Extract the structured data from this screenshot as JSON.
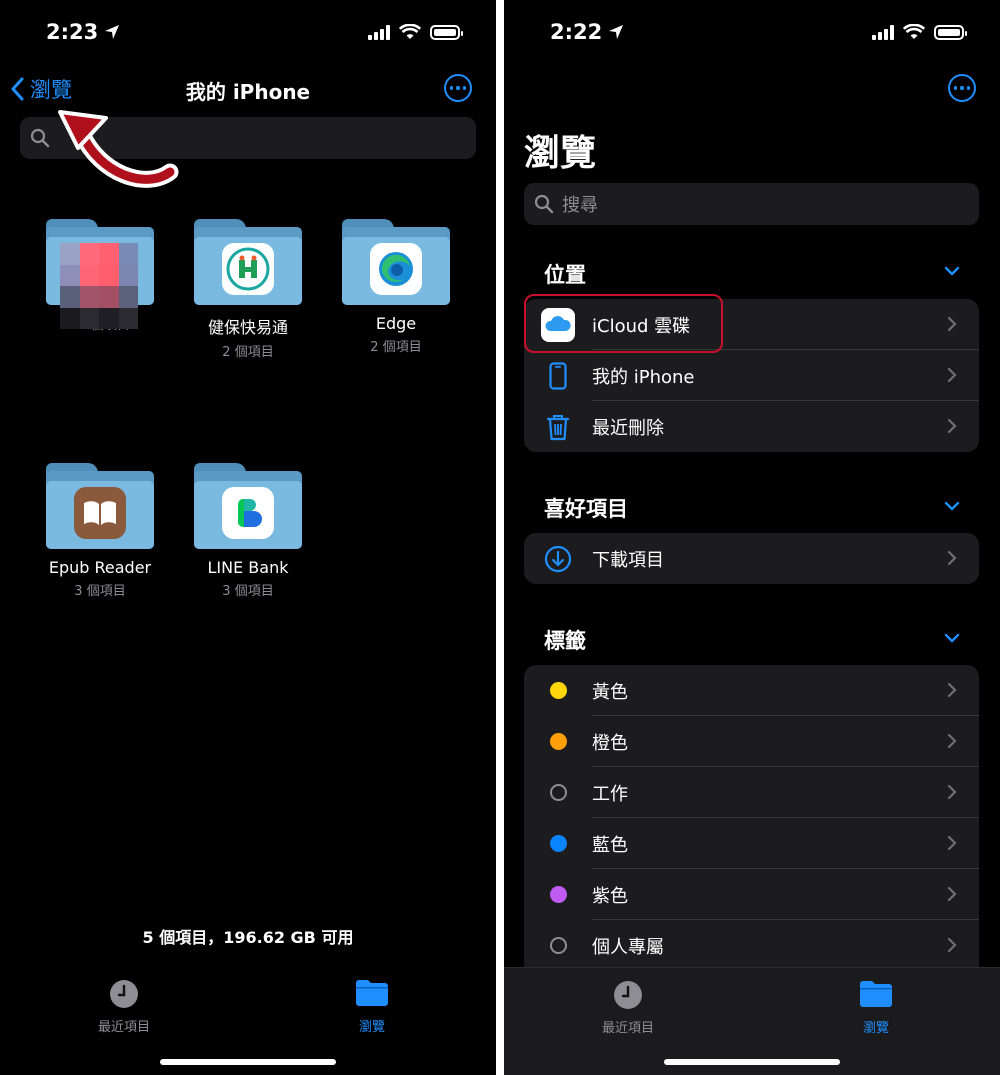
{
  "left": {
    "status_time": "2:23",
    "back_label": "瀏覽",
    "title": "我的 iPhone",
    "folders": [
      {
        "name": "",
        "count": "22 個項目"
      },
      {
        "name": "健保快易通",
        "count": "2 個項目"
      },
      {
        "name": "Edge",
        "count": "2 個項目"
      },
      {
        "name": "Epub Reader",
        "count": "3 個項目"
      },
      {
        "name": "LINE Bank",
        "count": "3 個項目"
      }
    ],
    "storage": "5 個項目，196.62 GB 可用",
    "tabs": [
      {
        "label": "最近項目"
      },
      {
        "label": "瀏覽"
      }
    ]
  },
  "right": {
    "status_time": "2:22",
    "title": "瀏覽",
    "search_placeholder": "搜尋",
    "sections": {
      "locations": {
        "title": "位置",
        "items": [
          {
            "label": "iCloud 雲碟",
            "icon": "icloud-icon"
          },
          {
            "label": "我的 iPhone",
            "icon": "iphone-icon"
          },
          {
            "label": "最近刪除",
            "icon": "trash-icon"
          }
        ]
      },
      "favorites": {
        "title": "喜好項目",
        "items": [
          {
            "label": "下載項目",
            "icon": "download-icon"
          }
        ]
      },
      "tags": {
        "title": "標籤",
        "items": [
          {
            "label": "黃色",
            "color": "#ffd60a"
          },
          {
            "label": "橙色",
            "color": "#ff9f0a"
          },
          {
            "label": "工作",
            "color": "none"
          },
          {
            "label": "藍色",
            "color": "#0a84ff"
          },
          {
            "label": "紫色",
            "color": "#bf5af2"
          },
          {
            "label": "個人專屬",
            "color": "none"
          }
        ]
      }
    },
    "tabs": [
      {
        "label": "最近項目"
      },
      {
        "label": "瀏覽"
      }
    ]
  },
  "colors": {
    "accent": "#1f8fff",
    "highlight": "#c8102e"
  }
}
